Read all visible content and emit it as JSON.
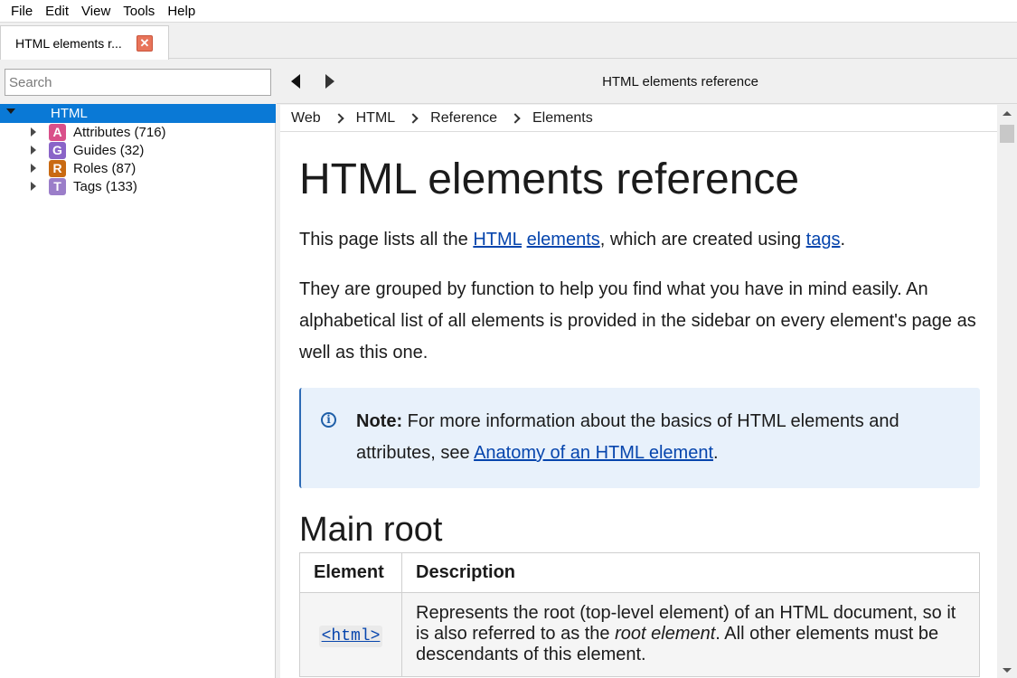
{
  "menubar": {
    "items": [
      "File",
      "Edit",
      "View",
      "Tools",
      "Help"
    ]
  },
  "tabs": [
    {
      "label": "HTML elements r...",
      "close_icon": "close-icon"
    }
  ],
  "sidebar": {
    "search_placeholder": "Search",
    "tree": {
      "root": {
        "label": "HTML"
      },
      "items": [
        {
          "badge": "A",
          "label": "Attributes (716)",
          "color": "#d9508a"
        },
        {
          "badge": "G",
          "label": "Guides (32)",
          "color": "#8a64c8"
        },
        {
          "badge": "R",
          "label": "Roles (87)",
          "color": "#c96a12"
        },
        {
          "badge": "T",
          "label": "Tags (133)",
          "color": "#9b7ec9"
        }
      ]
    }
  },
  "nav": {
    "title": "HTML elements reference"
  },
  "breadcrumb": [
    "Web",
    "HTML",
    "Reference",
    "Elements"
  ],
  "article": {
    "title": "HTML elements reference",
    "p1": {
      "t1": "This page lists all the ",
      "link1": "HTML",
      "t2": " ",
      "link2": "elements",
      "t3": ", which are created using ",
      "link3": "tags",
      "t4": "."
    },
    "p2": "They are grouped by function to help you find what you have in mind easily. An alphabetical list of all elements is provided in the sidebar on every element's page as well as this one.",
    "note": {
      "bold": "Note:",
      "text": " For more information about the basics of HTML elements and attributes, see ",
      "link": "Anatomy of an HTML element",
      "end": "."
    },
    "section_title": "Main root",
    "table": {
      "headers": [
        "Element",
        "Description"
      ],
      "rows": [
        {
          "element": "<html>",
          "desc_pre": "Represents the root (top-level element) of an HTML document, so it is also referred to as the ",
          "desc_em": "root element",
          "desc_post": ". All other elements must be descendants of this element."
        }
      ]
    }
  },
  "colors": {
    "selection": "#0a79d6",
    "link": "#0645ad",
    "note_bg": "#e8f1fb",
    "tab_close": "#e8745a"
  }
}
